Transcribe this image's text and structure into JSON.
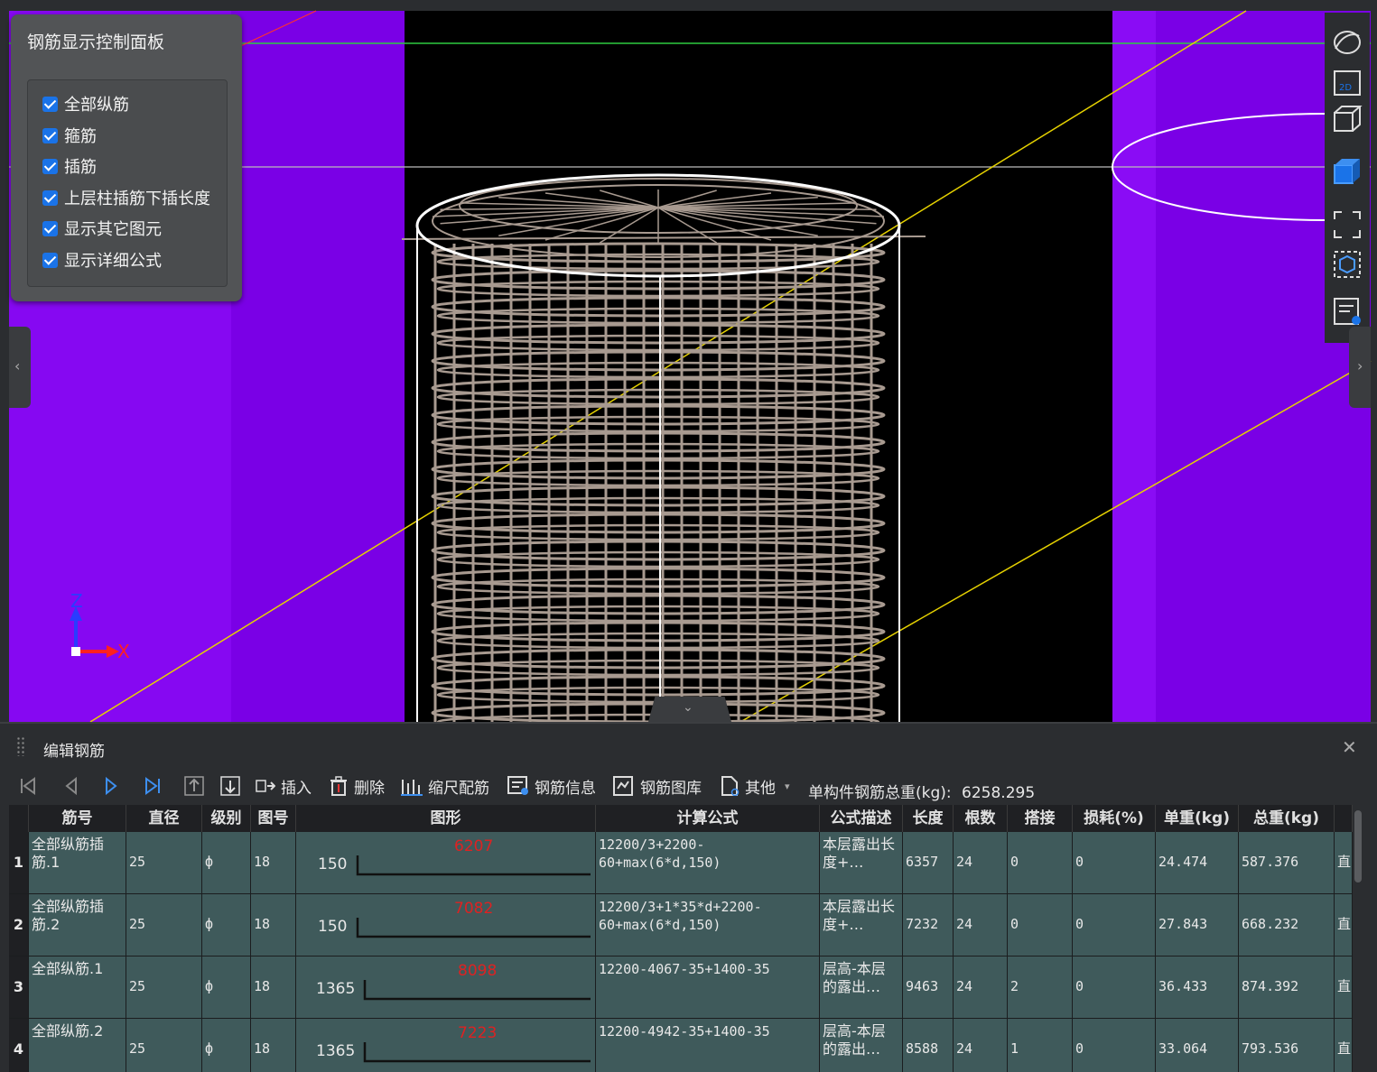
{
  "control_panel": {
    "title": "钢筋显示控制面板",
    "options": [
      {
        "label": "全部纵筋",
        "checked": true
      },
      {
        "label": "箍筋",
        "checked": true
      },
      {
        "label": "插筋",
        "checked": true
      },
      {
        "label": "上层柱插筋下插长度",
        "checked": true
      },
      {
        "label": "显示其它图元",
        "checked": true
      },
      {
        "label": "显示详细公式",
        "checked": true
      }
    ]
  },
  "axes": {
    "z": "Z",
    "x": "X"
  },
  "right_toolbar": [
    "orbit-icon",
    "2d-view-icon",
    "3d-view-icon",
    "3d-solid-view-icon",
    "fit-view-icon",
    "select-box-icon",
    "report-icon"
  ],
  "right_toolbar_2d": "2D",
  "edit_panel": {
    "title": "编辑钢筋",
    "toolbar": {
      "insert": "插入",
      "delete": "删除",
      "scale": "缩尺配筋",
      "info": "钢筋信息",
      "library": "钢筋图库",
      "other": "其他",
      "total_weight_label": "单构件钢筋总重(kg):",
      "total_weight_value": "6258.295"
    },
    "columns": [
      "筋号",
      "直径(mm)",
      "级别",
      "图号",
      "图形",
      "计算公式",
      "公式描述",
      "长度",
      "根数",
      "搭接",
      "损耗(%)",
      "单重(kg)",
      "总重(kg)"
    ],
    "rows": [
      {
        "num": "1",
        "name": "全部纵筋插筋.1",
        "dia": "25",
        "grade": "ф",
        "fig": "18",
        "shape_left": "150",
        "shape_len": "6207",
        "formula": "12200/3+2200-60+max(6*d,150)",
        "desc": "本层露出长度+…",
        "length": "6357",
        "count": "24",
        "lap": "0",
        "loss": "0",
        "unit": "24.474",
        "total": "587.376",
        "more": "直"
      },
      {
        "num": "2",
        "name": "全部纵筋插筋.2",
        "dia": "25",
        "grade": "ф",
        "fig": "18",
        "shape_left": "150",
        "shape_len": "7082",
        "formula": "12200/3+1*35*d+2200-60+max(6*d,150)",
        "desc": "本层露出长度+…",
        "length": "7232",
        "count": "24",
        "lap": "0",
        "loss": "0",
        "unit": "27.843",
        "total": "668.232",
        "more": "直"
      },
      {
        "num": "3",
        "name": "全部纵筋.1",
        "dia": "25",
        "grade": "ф",
        "fig": "18",
        "shape_left": "1365",
        "shape_len": "8098",
        "formula": "12200-4067-35+1400-35",
        "desc": "层高-本层的露出…",
        "length": "9463",
        "count": "24",
        "lap": "2",
        "loss": "0",
        "unit": "36.433",
        "total": "874.392",
        "more": "直"
      },
      {
        "num": "4",
        "name": "全部纵筋.2",
        "dia": "25",
        "grade": "ф",
        "fig": "18",
        "shape_left": "1365",
        "shape_len": "7223",
        "formula": "12200-4942-35+1400-35",
        "desc": "层高-本层的露出…",
        "length": "8588",
        "count": "24",
        "lap": "1",
        "loss": "0",
        "unit": "33.064",
        "total": "793.536",
        "more": "直"
      }
    ]
  },
  "colors": {
    "purple": "#7a00e6",
    "row_bg": "#3f5a5b",
    "accent": "#1a73e8",
    "dim_red": "#d22222"
  }
}
